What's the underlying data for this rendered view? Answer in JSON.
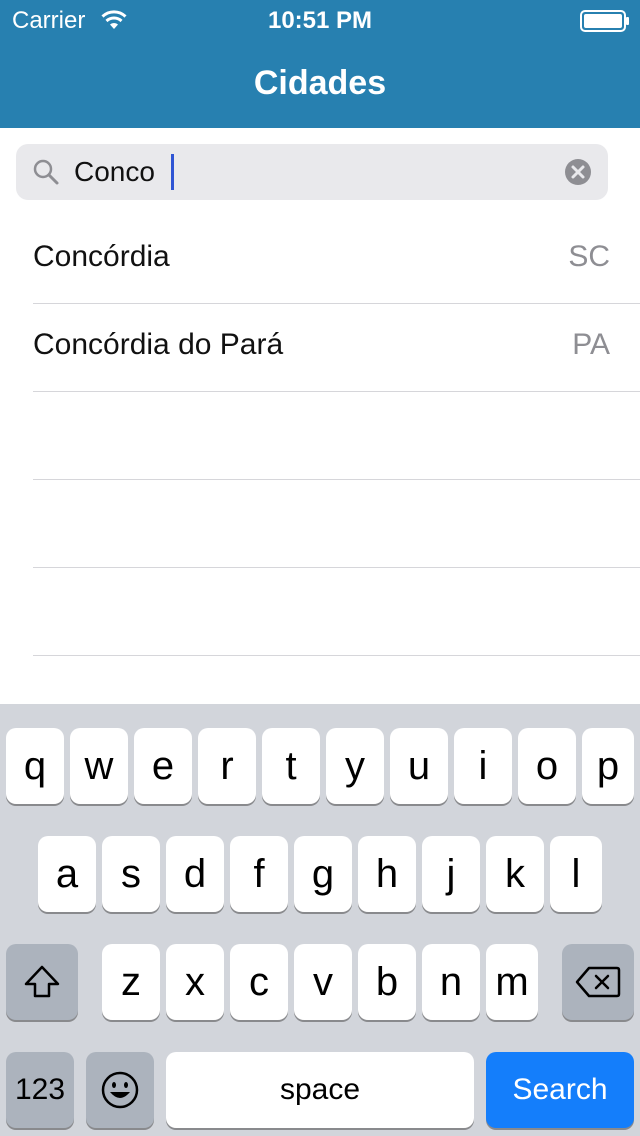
{
  "status_bar": {
    "carrier": "Carrier",
    "time": "10:51 PM",
    "wifi_icon": "wifi-icon",
    "battery_icon": "battery-icon"
  },
  "nav": {
    "title": "Cidades",
    "background_color": "#2780b0"
  },
  "search": {
    "value": "Conco",
    "search_icon": "search-icon",
    "clear_icon": "clear-icon"
  },
  "results": [
    {
      "city": "Concórdia",
      "state": "SC"
    },
    {
      "city": "Concórdia do Pará",
      "state": "PA"
    },
    {
      "city": "",
      "state": ""
    },
    {
      "city": "",
      "state": ""
    },
    {
      "city": "",
      "state": ""
    }
  ],
  "keyboard": {
    "row1": [
      "q",
      "w",
      "e",
      "r",
      "t",
      "y",
      "u",
      "i",
      "o",
      "p"
    ],
    "row2": [
      "a",
      "s",
      "d",
      "f",
      "g",
      "h",
      "j",
      "k",
      "l"
    ],
    "row3": [
      "z",
      "x",
      "c",
      "v",
      "b",
      "n",
      "m"
    ],
    "shift_icon": "shift-icon",
    "delete_icon": "delete-icon",
    "numbers_label": "123",
    "emoji_icon": "emoji-icon",
    "space_label": "space",
    "search_label": "Search",
    "accent_color": "#147efb"
  }
}
